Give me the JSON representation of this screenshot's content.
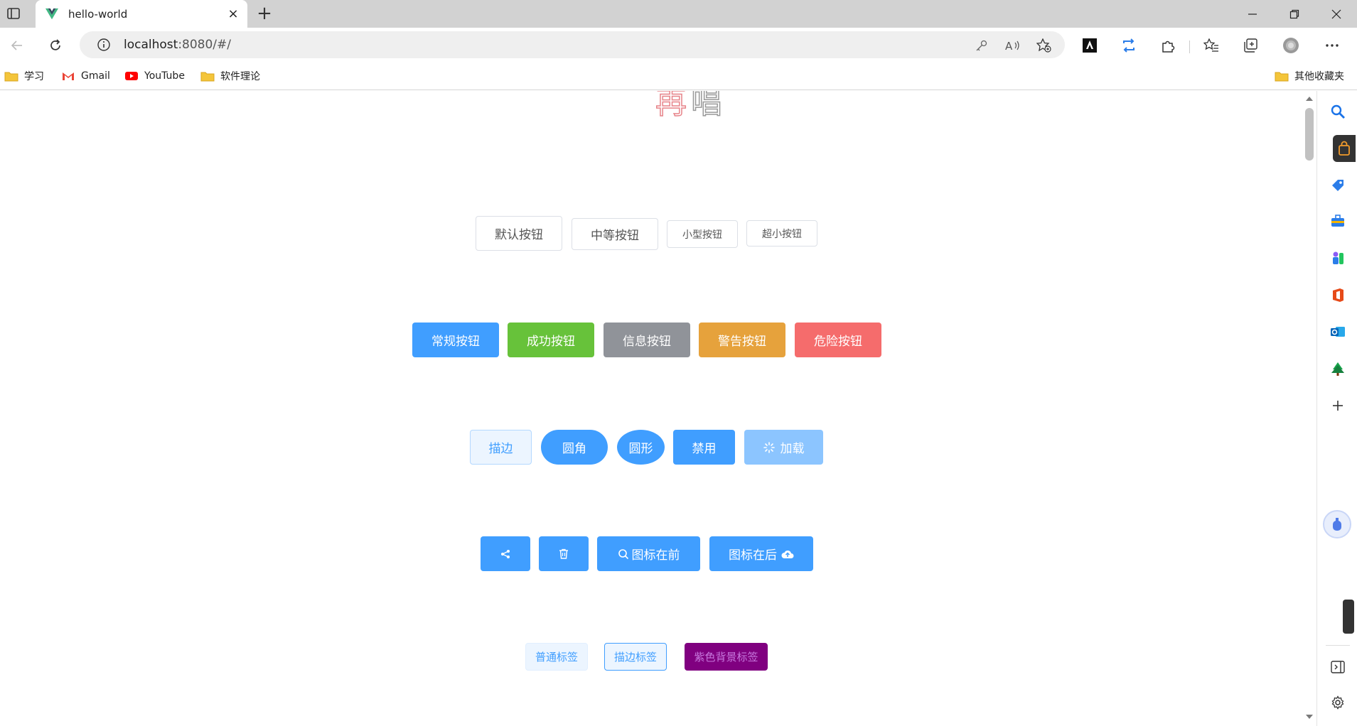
{
  "browser": {
    "tab_title": "hello-world",
    "url_host": "localhost",
    "url_rest": ":8080/#/",
    "new_tab_glyph": "+",
    "close_glyph": "×"
  },
  "bookmarks": {
    "items": [
      {
        "label": "学习",
        "icon": "folder-icon"
      },
      {
        "label": "Gmail",
        "icon": "gmail-icon"
      },
      {
        "label": "YouTube",
        "icon": "youtube-icon"
      },
      {
        "label": "软件理论",
        "icon": "folder-icon"
      }
    ],
    "other": "其他收藏夹"
  },
  "page": {
    "logo": [
      "再",
      "唱"
    ],
    "size_buttons": [
      "默认按钮",
      "中等按钮",
      "小型按钮",
      "超小按钮"
    ],
    "type_buttons": [
      "常规按钮",
      "成功按钮",
      "信息按钮",
      "警告按钮",
      "危险按钮"
    ],
    "style_buttons": [
      "描边",
      "圆角",
      "圆形",
      "禁用",
      "加载"
    ],
    "icon_buttons": {
      "search_label": "图标在前",
      "upload_label": "图标在后"
    },
    "tags": [
      "普通标签",
      "描边标签",
      "紫色背景标签"
    ]
  },
  "colors": {
    "primary": "#409eff",
    "success": "#67c23a",
    "info": "#909399",
    "warning": "#e6a23c",
    "danger": "#f56c6c",
    "purple": "#800080"
  }
}
